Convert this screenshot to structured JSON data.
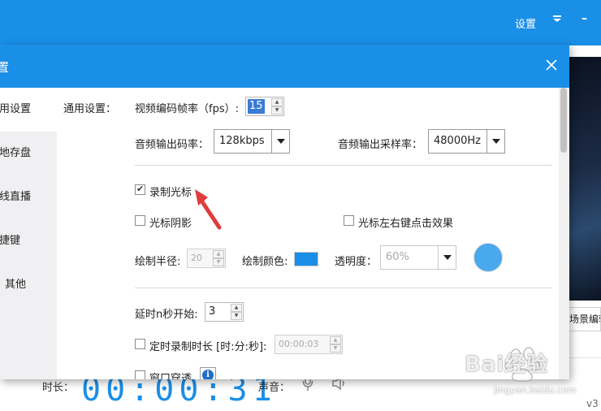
{
  "app": {
    "top_settings": "设置",
    "scene_button": "场景编辑",
    "duration_label": "时长：",
    "timer": "00:00:31",
    "volume_label": "声音：",
    "version": "v3"
  },
  "dialog": {
    "title": "置"
  },
  "nav": {
    "items": [
      {
        "label": "通用设置"
      },
      {
        "label": "本地存盘"
      },
      {
        "label": "在线直播"
      },
      {
        "label": "快捷键"
      },
      {
        "label": "其他"
      }
    ]
  },
  "general": {
    "section_label": "通用设置：",
    "fps_label": "视频编码帧率（fps）:",
    "fps_value": "15",
    "audio_bitrate_label": "音频输出码率：",
    "audio_bitrate_value": "128kbps",
    "sample_rate_label": "音频输出采样率：",
    "sample_rate_value": "48000Hz",
    "record_cursor_label": "录制光标",
    "record_cursor_checked": true,
    "cursor_shadow_label": "光标阴影",
    "cursor_shadow_checked": false,
    "click_effect_label": "光标左右键点击效果",
    "click_effect_checked": false,
    "radius_label": "绘制半径:",
    "radius_value": "20",
    "color_label": "绘制颜色:",
    "draw_color": "#1a8fe8",
    "opacity_label": "透明度：",
    "opacity_value": "60%",
    "delay_label": "延时n秒开始:",
    "delay_value": "3",
    "timed_label": "定时录制时长 [时:分:秒]:",
    "timed_checked": false,
    "timed_value": "00:00:03",
    "window_through_label": "窗口穿透",
    "window_through_checked": false
  },
  "watermark": {
    "brand": "Bai经验",
    "url": "jingyan.baidu.com"
  },
  "colors": {
    "accent": "#1a8fe8",
    "selection": "#3a7bd5",
    "annotation": "#e03c3c"
  }
}
